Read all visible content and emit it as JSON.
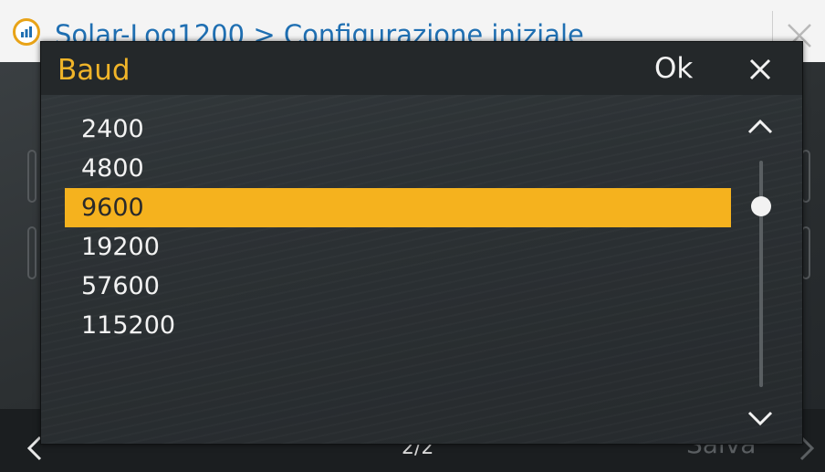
{
  "app": {
    "breadcrumb": "Solar-Log1200 > Configurazione iniziale",
    "footer": {
      "page": "2/2",
      "save_label": "Salva"
    }
  },
  "dialog": {
    "title": "Baud",
    "ok_label": "Ok",
    "options": [
      "2400",
      "4800",
      "9600",
      "19200",
      "57600",
      "115200"
    ],
    "selected": "9600"
  },
  "colors": {
    "accent": "#f5b21e",
    "title": "#f0b429",
    "link": "#1f6fb2"
  },
  "icons": {
    "logo": "solar-log-logo-icon",
    "close": "close-icon",
    "scroll_up": "chevron-up-icon",
    "scroll_down": "chevron-down-icon",
    "back": "chevron-left-icon",
    "next": "chevron-right-icon"
  }
}
